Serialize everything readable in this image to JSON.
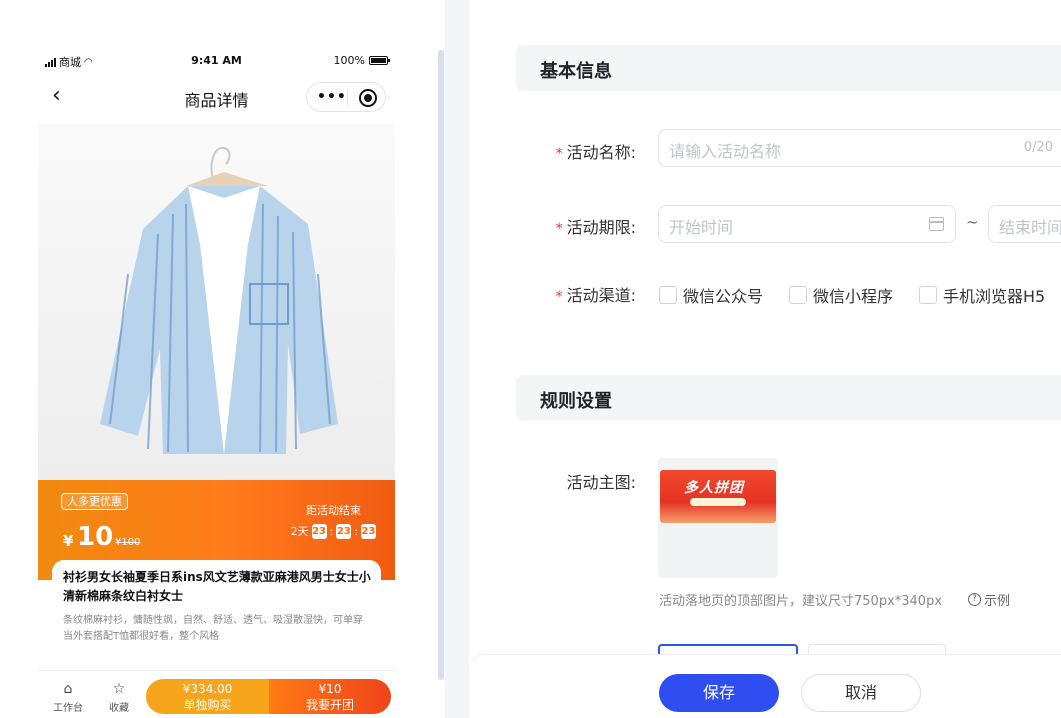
{
  "preview": {
    "status_bar": {
      "carrier": "商城",
      "time": "9:41 AM",
      "battery": "100%"
    },
    "nav": {
      "title": "商品详情",
      "more": "•••"
    },
    "promo": {
      "tag": "人多更优惠",
      "currency": "¥",
      "price": "10",
      "original_price": "¥100",
      "countdown_label": "距活动结束",
      "days": "2天",
      "hours": "23",
      "minutes": "23",
      "seconds": "23"
    },
    "product": {
      "title": "衬衫男女长袖夏季日系ins风文艺薄款亚麻港风男士女士小清新棉麻条纹白衬女士",
      "description": "条纹棉麻衬衫，慵随性飒，自然、舒适、透气、吸湿散湿快，可单穿当外套搭配T恤都很好看，整个风格"
    },
    "bottom": {
      "workbench": "工作台",
      "favorite": "收藏",
      "single_price": "¥334.00",
      "single_label": "单独购买",
      "group_price": "¥10",
      "group_label": "我要开团"
    }
  },
  "form": {
    "basic_section": "基本信息",
    "activity_name": {
      "label": "活动名称:",
      "placeholder": "请输入活动名称",
      "counter": "0/20"
    },
    "period": {
      "label": "活动期限:",
      "start_placeholder": "开始时间",
      "separator": "~",
      "end_placeholder": "结束时间"
    },
    "channel": {
      "label": "活动渠道:",
      "options": [
        "微信公众号",
        "微信小程序",
        "手机浏览器H5"
      ]
    },
    "rules_section": "规则设置",
    "main_image": {
      "label": "活动主图:",
      "banner_text": "多人拼团",
      "help": "活动落地页的顶部图片，建议尺寸750px*340px",
      "example": "示例"
    },
    "required_mark": "*",
    "save": "保存",
    "cancel": "取消"
  },
  "colors": {
    "primary": "#2f4ef1",
    "promo_orange": "#ff7a1a",
    "required": "#e5352b"
  }
}
